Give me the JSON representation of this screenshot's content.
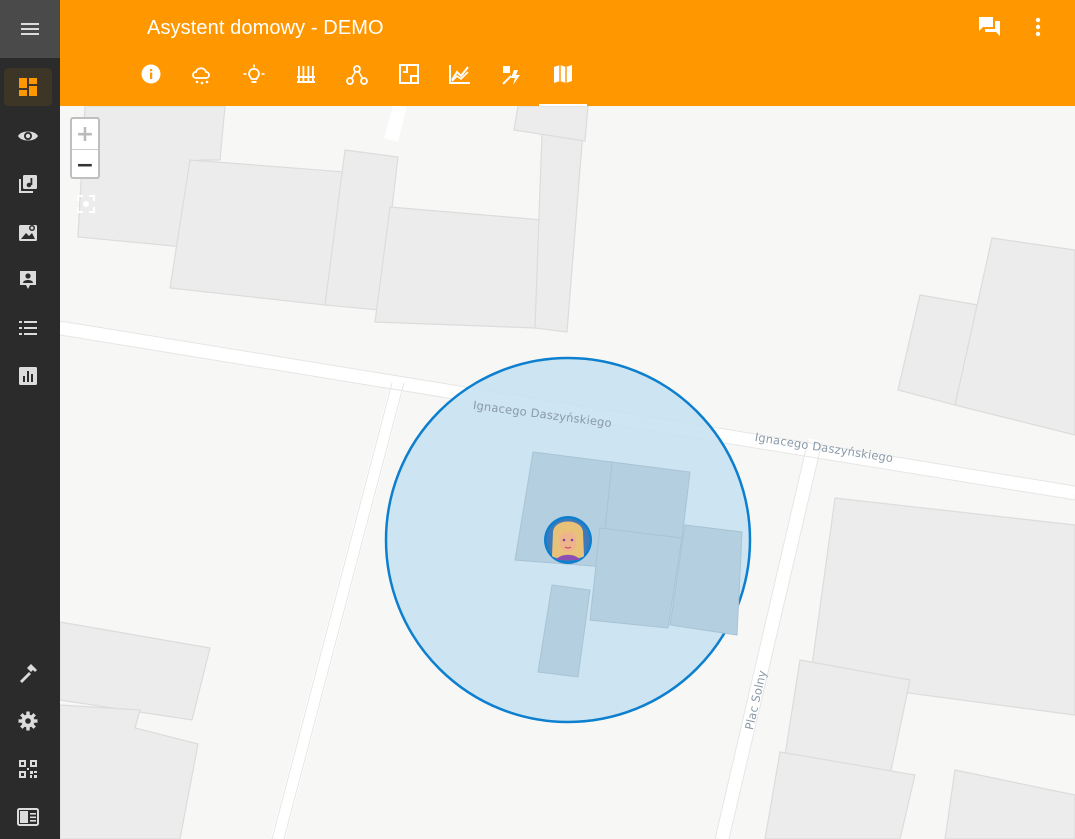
{
  "app": {
    "title": "Asystent domowy - DEMO"
  },
  "sidebar": {
    "items": [
      {
        "icon": "view-dashboard-icon",
        "active": true
      },
      {
        "icon": "eye-icon"
      },
      {
        "icon": "music-library-icon"
      },
      {
        "icon": "image-search-icon"
      },
      {
        "icon": "account-box-icon"
      },
      {
        "icon": "format-list-bulleted-icon"
      },
      {
        "icon": "chart-box-icon"
      },
      {
        "icon": "hammer-icon"
      },
      {
        "icon": "gear-icon"
      },
      {
        "icon": "qrcode-icon"
      },
      {
        "icon": "book-open-icon"
      }
    ]
  },
  "header_actions": [
    {
      "icon": "chat-icon"
    },
    {
      "icon": "more-vert-icon"
    }
  ],
  "tabs": [
    {
      "icon": "info-icon"
    },
    {
      "icon": "weather-icon"
    },
    {
      "icon": "lightbulb-icon"
    },
    {
      "icon": "heater-icon"
    },
    {
      "icon": "graph-nodes-icon"
    },
    {
      "icon": "floor-plan-icon"
    },
    {
      "icon": "area-chart-icon"
    },
    {
      "icon": "energy-icon"
    },
    {
      "icon": "map-icon",
      "active": true
    }
  ],
  "map": {
    "zoom_in": "+",
    "zoom_out": "−",
    "streets": {
      "street_1": "Ignacego Daszyńskiego",
      "street_2": "Ignacego Daszyńskiego",
      "street_3": "Plac Solny"
    },
    "colors": {
      "zone_fill": "#c5e1f1",
      "zone_stroke": "#0d7fcf",
      "accent": "#ff9800"
    }
  }
}
